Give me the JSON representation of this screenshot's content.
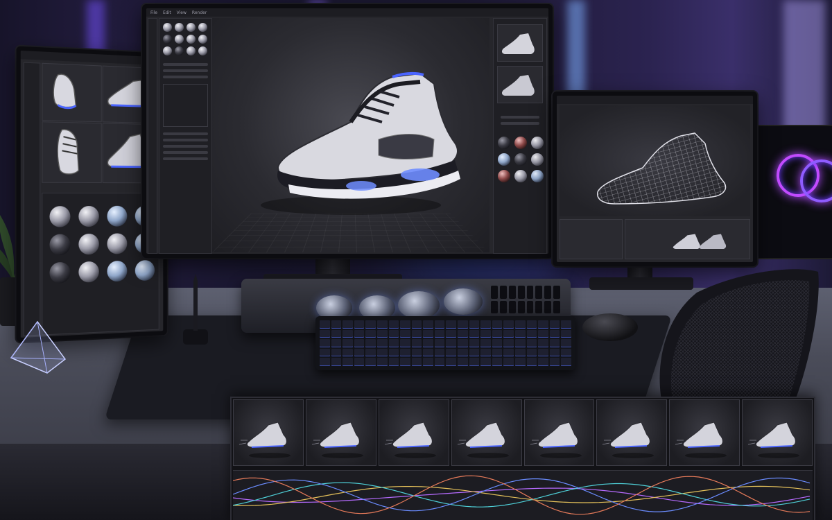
{
  "scene": {
    "main_monitor": {
      "menu": [
        "File",
        "Edit",
        "View",
        "Render"
      ],
      "viewport_object": "sneaker-3d-model",
      "right_thumbs": 2,
      "material_balls": 9
    },
    "left_tablet": {
      "thumbnails": 4,
      "material_balls": 12
    },
    "right_monitor": {
      "view_mode": "wireframe",
      "bottom_panels": 3
    },
    "timeline": {
      "frame_count": 8,
      "curve_colors": [
        "#b66bff",
        "#e4c05a",
        "#4fd1d9",
        "#6b8cff",
        "#e87b5a"
      ]
    },
    "colors": {
      "accent": "#5a7dff",
      "purple_light": "#9b6bff",
      "ui_dark": "#26262b"
    }
  }
}
